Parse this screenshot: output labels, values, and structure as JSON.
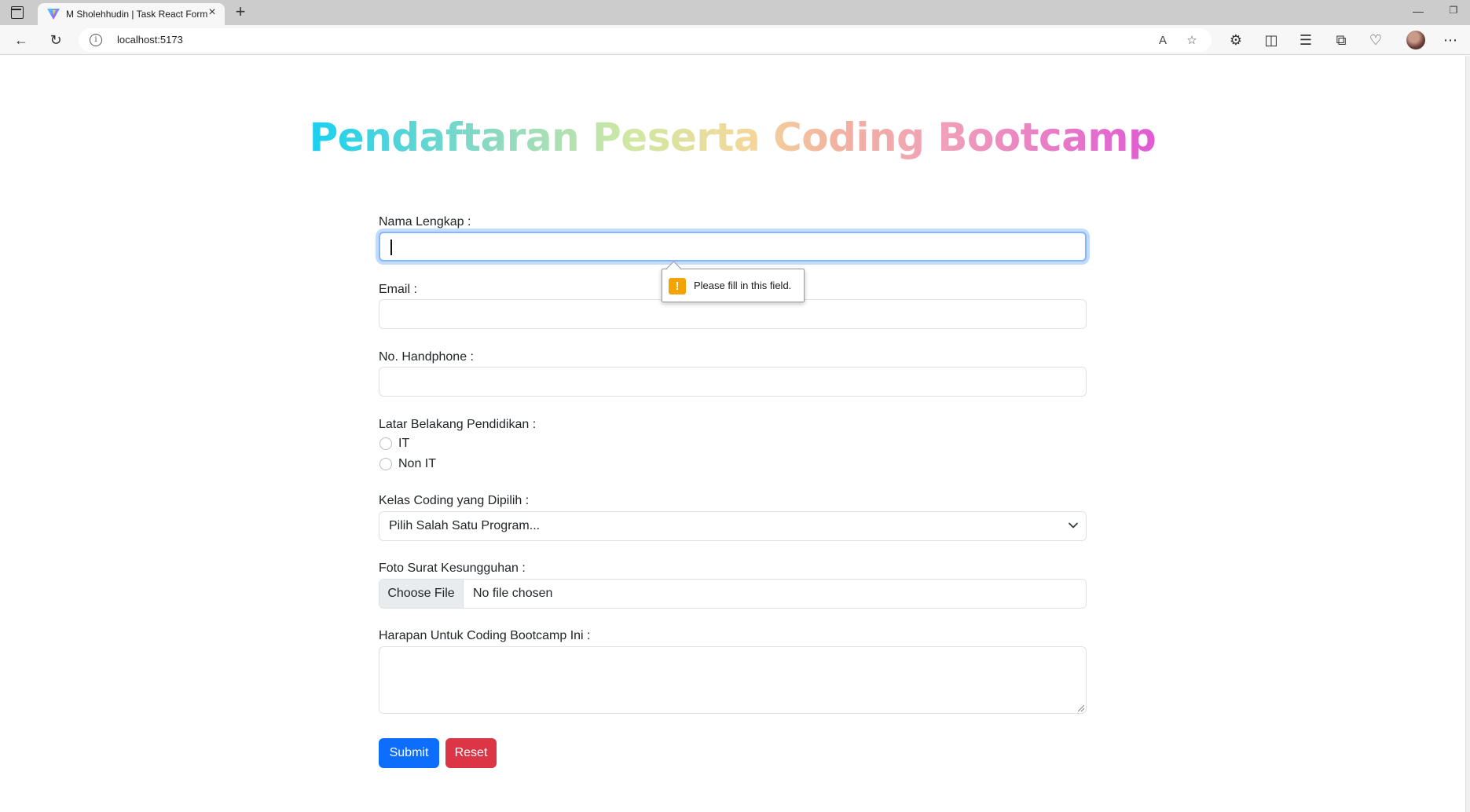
{
  "browser": {
    "tab_title": "M Sholehhudin | Task React Form",
    "new_tab_symbol": "+",
    "tab_close_symbol": "×",
    "address": "localhost:5173",
    "address_info_symbol": "i"
  },
  "page": {
    "title": "Pendaftaran Peserta Coding Bootcamp",
    "title_gradient": [
      "#19d0f0",
      "#cfe8a3",
      "#f4d79a",
      "#f0a0b8",
      "#e05ad4"
    ]
  },
  "form": {
    "nama_label": "Nama Lengkap :",
    "nama_value": "",
    "email_label": "Email :",
    "email_value": "",
    "hp_label": "No. Handphone :",
    "hp_value": "",
    "pendidikan_label": "Latar Belakang Pendidikan :",
    "pendidikan_options": [
      "IT",
      "Non IT"
    ],
    "kelas_label": "Kelas Coding yang Dipilih :",
    "kelas_selected": "Pilih Salah Satu Program...",
    "foto_label": "Foto Surat Kesungguhan :",
    "foto_button": "Choose File",
    "foto_status": "No file chosen",
    "harapan_label": "Harapan Untuk Coding Bootcamp Ini :",
    "harapan_value": "",
    "submit_label": "Submit",
    "reset_label": "Reset"
  },
  "validation": {
    "message": "Please fill in this field.",
    "icon_symbol": "!",
    "icon_color": "#f5a300"
  },
  "colors": {
    "primary": "#0d6efd",
    "danger": "#dc3545",
    "focus_border": "#86b7fe"
  }
}
